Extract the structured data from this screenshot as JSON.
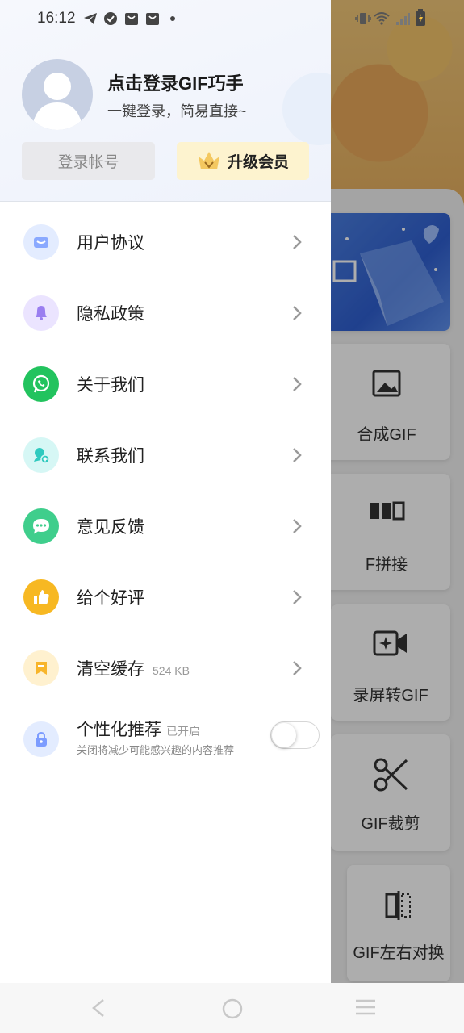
{
  "status_bar": {
    "time": "16:12"
  },
  "drawer": {
    "profile": {
      "title": "点击登录GIF巧手",
      "subtitle": "一键登录，简易直接~"
    },
    "login_label": "登录帐号",
    "vip_label": "升级会员",
    "menu": [
      {
        "label": "用户协议",
        "icon": "mail-icon",
        "color": "#9ab8ff"
      },
      {
        "label": "隐私政策",
        "icon": "bell-icon",
        "color": "#a98cf0"
      },
      {
        "label": "关于我们",
        "icon": "whatsapp-icon",
        "color": "#22c35e"
      },
      {
        "label": "联系我们",
        "icon": "contact-icon",
        "color": "#35cfc8"
      },
      {
        "label": "意见反馈",
        "icon": "chat-icon",
        "color": "#3fce8c"
      },
      {
        "label": "给个好评",
        "icon": "thumbs-up-icon",
        "color": "#f7b822"
      },
      {
        "label": "清空缓存",
        "icon": "bookmark-icon",
        "color": "#f8c238",
        "extra": "524 KB"
      }
    ],
    "personalized": {
      "label": "个性化推荐",
      "status": "已开启",
      "description": "关闭将减少可能感兴趣的内容推荐",
      "toggle_on": false
    }
  },
  "background_app": {
    "tools": [
      {
        "label": "合成GIF"
      },
      {
        "label": "F拼接"
      },
      {
        "label": "录屏转GIF"
      },
      {
        "label": "GIF裁剪"
      },
      {
        "label": "GIF左右对换"
      }
    ]
  }
}
